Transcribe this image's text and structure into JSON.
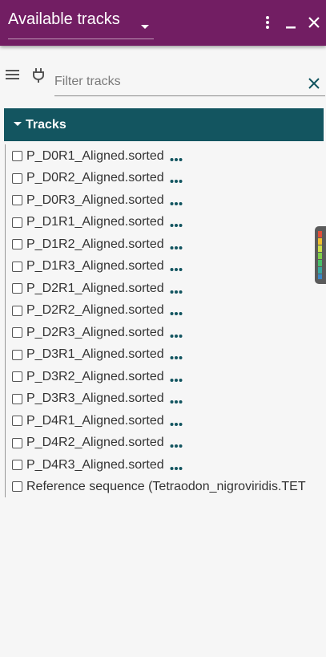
{
  "header": {
    "title": "Available tracks",
    "icons": [
      "dropdown-caret-icon",
      "more-vert-icon",
      "minimize-icon",
      "close-icon"
    ],
    "background_color": "#721e63"
  },
  "toolbar": {
    "icons": [
      "hamburger-menu-icon",
      "plug-icon"
    ],
    "filter_placeholder": "Filter tracks",
    "filter_value": ""
  },
  "category": {
    "label": "Tracks",
    "expanded": true,
    "background_color": "#135560"
  },
  "tracks": [
    {
      "label": "P_D0R1_Aligned.sorted",
      "checked": false,
      "has_menu": true
    },
    {
      "label": "P_D0R2_Aligned.sorted",
      "checked": false,
      "has_menu": true
    },
    {
      "label": "P_D0R3_Aligned.sorted",
      "checked": false,
      "has_menu": true
    },
    {
      "label": "P_D1R1_Aligned.sorted",
      "checked": false,
      "has_menu": true
    },
    {
      "label": "P_D1R2_Aligned.sorted",
      "checked": false,
      "has_menu": true
    },
    {
      "label": "P_D1R3_Aligned.sorted",
      "checked": false,
      "has_menu": true
    },
    {
      "label": "P_D2R1_Aligned.sorted",
      "checked": false,
      "has_menu": true
    },
    {
      "label": "P_D2R2_Aligned.sorted",
      "checked": false,
      "has_menu": true
    },
    {
      "label": "P_D2R3_Aligned.sorted",
      "checked": false,
      "has_menu": true
    },
    {
      "label": "P_D3R1_Aligned.sorted",
      "checked": false,
      "has_menu": true
    },
    {
      "label": "P_D3R2_Aligned.sorted",
      "checked": false,
      "has_menu": true
    },
    {
      "label": "P_D3R3_Aligned.sorted",
      "checked": false,
      "has_menu": true
    },
    {
      "label": "P_D4R1_Aligned.sorted",
      "checked": false,
      "has_menu": true
    },
    {
      "label": "P_D4R2_Aligned.sorted",
      "checked": false,
      "has_menu": true
    },
    {
      "label": "P_D4R3_Aligned.sorted",
      "checked": false,
      "has_menu": true
    },
    {
      "label": "Reference sequence (Tetraodon_nigroviridis.TET",
      "checked": false,
      "has_menu": false
    }
  ],
  "accent_color": "#135560"
}
